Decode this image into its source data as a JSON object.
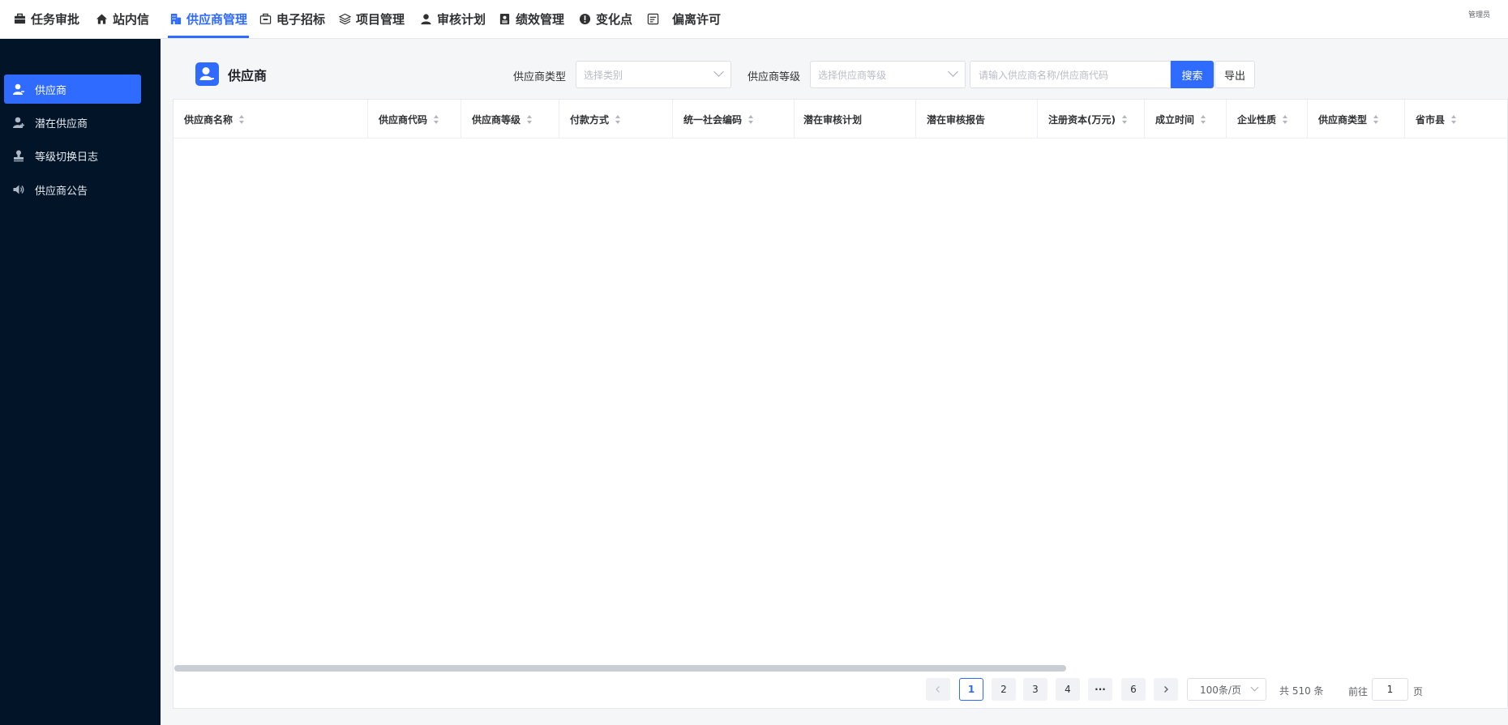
{
  "topnav": {
    "items": [
      {
        "label": "任务审批",
        "icon": "briefcase-icon"
      },
      {
        "label": "站内信",
        "icon": "home-icon"
      },
      {
        "label": "供应商管理",
        "icon": "building-icon"
      },
      {
        "label": "电子招标",
        "icon": "tender-icon"
      },
      {
        "label": "项目管理",
        "icon": "layers-icon"
      },
      {
        "label": "审核计划",
        "icon": "user-icon"
      },
      {
        "label": "绩效管理",
        "icon": "report-icon"
      },
      {
        "label": "变化点",
        "icon": "alert-icon"
      },
      {
        "label": "偏离许可",
        "icon": "document-icon"
      }
    ],
    "active_index": 2,
    "user": "管理员"
  },
  "sidebar": {
    "items": [
      {
        "label": "供应商",
        "icon": "user-icon"
      },
      {
        "label": "潜在供应商",
        "icon": "user-plus-icon"
      },
      {
        "label": "等级切换日志",
        "icon": "stamp-icon"
      },
      {
        "label": "供应商公告",
        "icon": "speaker-icon"
      }
    ],
    "active_index": 0
  },
  "page": {
    "title": "供应商",
    "filter_type_label": "供应商类型",
    "filter_type_placeholder": "选择类别",
    "filter_level_label": "供应商等级",
    "filter_level_placeholder": "选择供应商等级",
    "search_placeholder": "请输入供应商名称/供应商代码",
    "search_button": "搜索",
    "export_button": "导出"
  },
  "table": {
    "columns": [
      {
        "label": "供应商名称",
        "sortable": true
      },
      {
        "label": "供应商代码",
        "sortable": true
      },
      {
        "label": "供应商等级",
        "sortable": true
      },
      {
        "label": "付款方式",
        "sortable": true
      },
      {
        "label": "统一社会编码",
        "sortable": true
      },
      {
        "label": "潜在审核计划",
        "sortable": false
      },
      {
        "label": "潜在审核报告",
        "sortable": false
      },
      {
        "label": "注册资本(万元)",
        "sortable": true
      },
      {
        "label": "成立时间",
        "sortable": true
      },
      {
        "label": "企业性质",
        "sortable": true
      },
      {
        "label": "供应商类型",
        "sortable": true
      },
      {
        "label": "省市县",
        "sortable": true
      }
    ],
    "rows": []
  },
  "pagination": {
    "pages": [
      "1",
      "2",
      "3",
      "4",
      "···",
      "6"
    ],
    "current": "1",
    "page_size": "100条/页",
    "total": "共 510 条",
    "goto_label": "前往",
    "goto_value": "1",
    "page_suffix": "页"
  },
  "colors": {
    "accent": "#2f6bff",
    "sidebar_bg": "#021428"
  }
}
